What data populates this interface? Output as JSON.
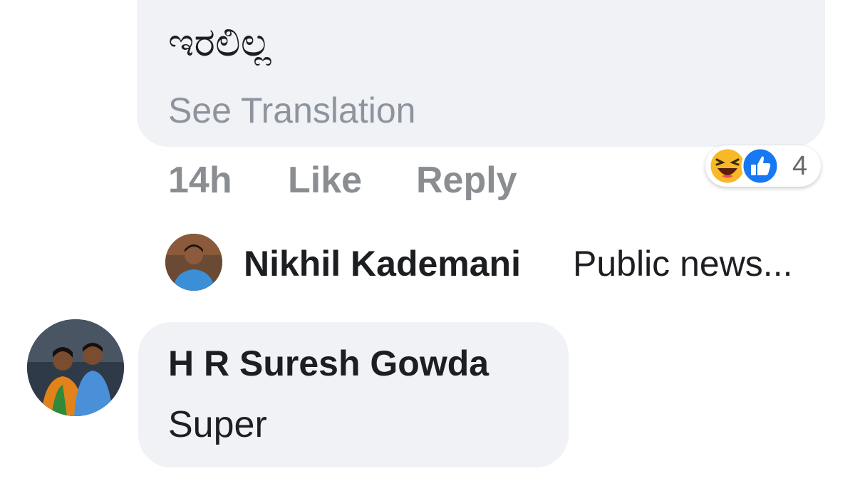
{
  "comment_1": {
    "text_kannada": "ಇರಲಿಲ್ಲ",
    "see_translation": "See Translation",
    "time": "14h",
    "like_label": "Like",
    "reply_label": "Reply",
    "reactions": {
      "types": [
        "haha-icon",
        "like-icon"
      ],
      "count": "4"
    }
  },
  "reply_preview": {
    "author": "Nikhil Kademani",
    "snippet": "Public news..."
  },
  "comment_2": {
    "author": "H R Suresh Gowda",
    "text": "Super"
  },
  "colors": {
    "bubble_bg": "#f0f2f5",
    "muted_text": "#8a8d91",
    "primary_text": "#1c1e21",
    "like_blue": "#1877f2",
    "haha_yellow": "#f7b928"
  }
}
